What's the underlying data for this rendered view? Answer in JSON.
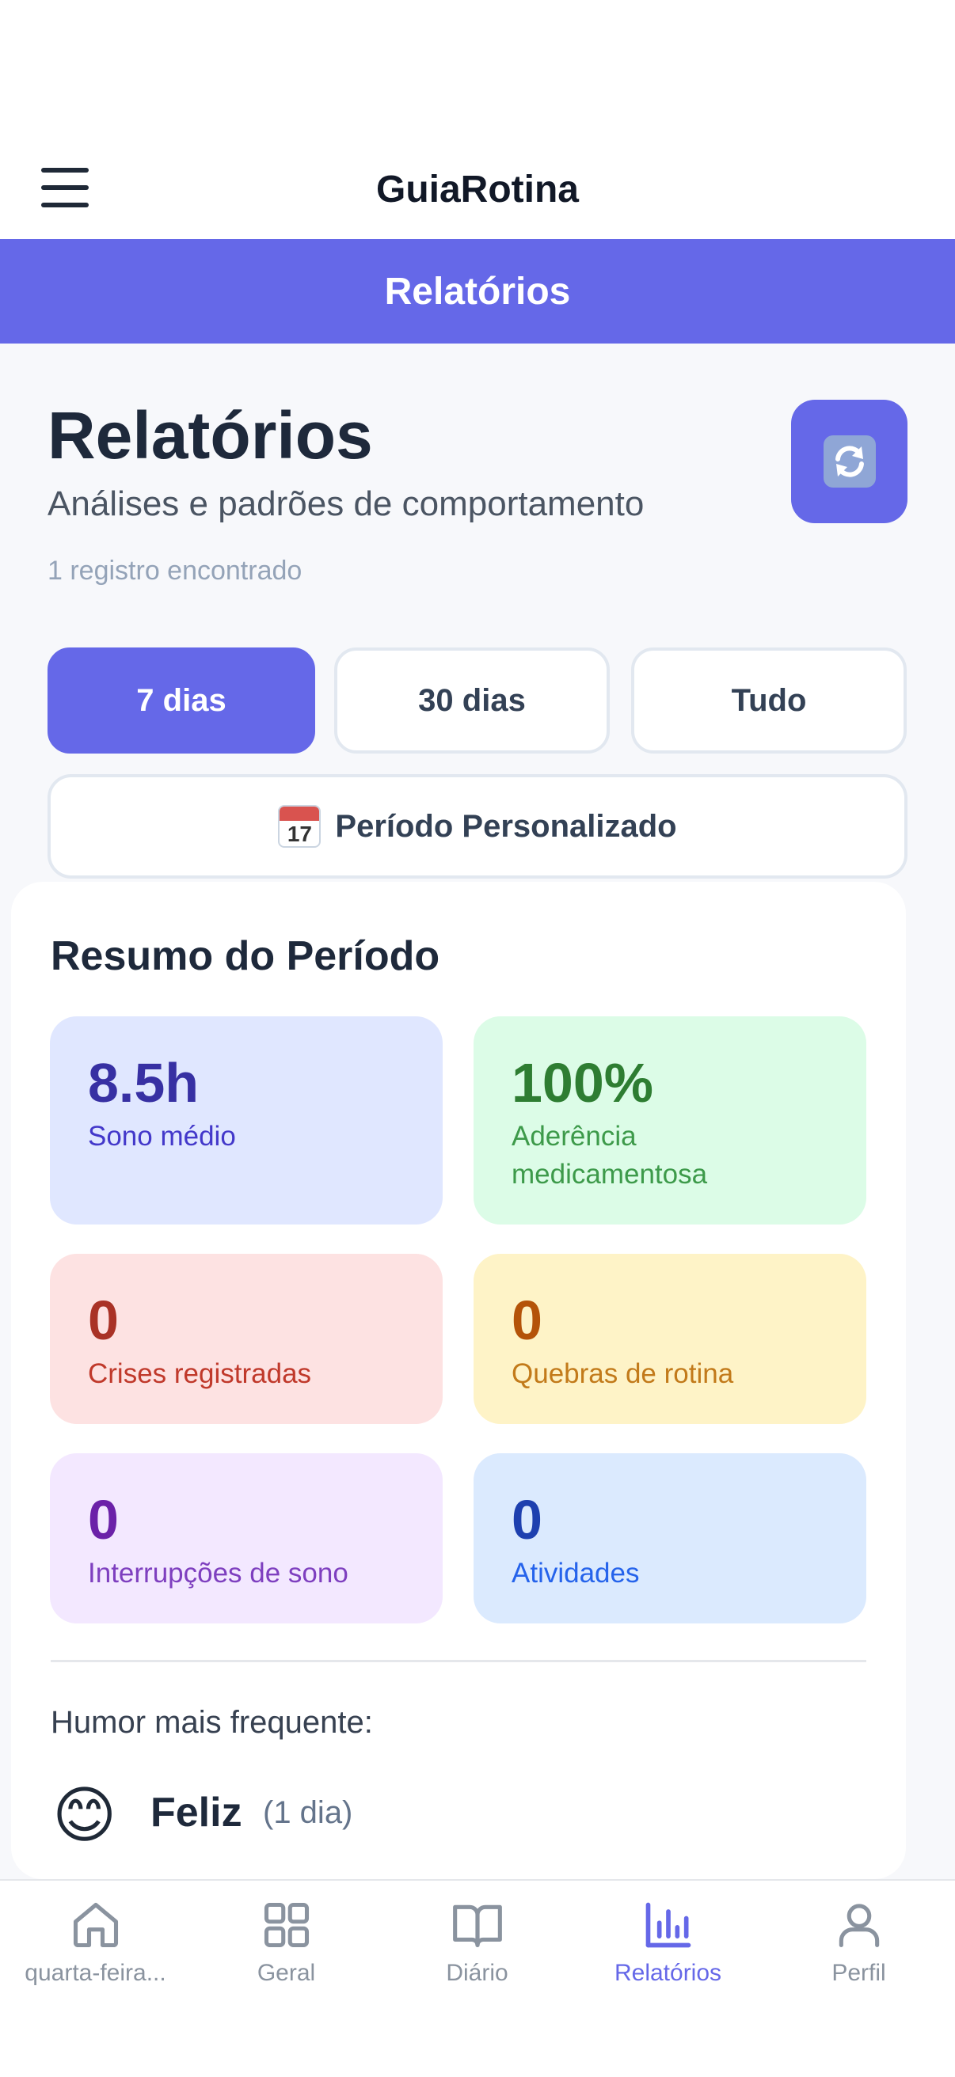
{
  "header": {
    "app_title": "GuiaRotina"
  },
  "section_bar": {
    "title": "Relatórios"
  },
  "page": {
    "title": "Relatórios",
    "subtitle": "Análises e padrões de comportamento",
    "record_count": "1 registro encontrado"
  },
  "periods": [
    {
      "label": "7 dias",
      "active": true
    },
    {
      "label": "30 dias",
      "active": false
    },
    {
      "label": "Tudo",
      "active": false
    }
  ],
  "custom_period": {
    "label": "Período Personalizado",
    "calendar_day": "17"
  },
  "summary": {
    "title": "Resumo do Período",
    "stats": [
      {
        "value": "8.5h",
        "label": "Sono médio",
        "bg": "#e0e7ff",
        "value_color": "#3730a3",
        "label_color": "#4338ca"
      },
      {
        "value": "100%",
        "label": "Aderência medicamentosa",
        "bg": "#dcfce7",
        "value_color": "#2e7d32",
        "label_color": "#3d9a4a"
      },
      {
        "value": "0",
        "label": "Crises registradas",
        "bg": "#fde2e2",
        "value_color": "#a93226",
        "label_color": "#c0392b"
      },
      {
        "value": "0",
        "label": "Quebras de rotina",
        "bg": "#fef3c7",
        "value_color": "#b45309",
        "label_color": "#c27a1a"
      },
      {
        "value": "0",
        "label": "Interrupções de sono",
        "bg": "#f3e8ff",
        "value_color": "#6b21a8",
        "label_color": "#7e3fbf"
      },
      {
        "value": "0",
        "label": "Atividades",
        "bg": "#dbeafe",
        "value_color": "#1e40af",
        "label_color": "#2563eb"
      }
    ],
    "mood": {
      "label": "Humor mais frequente:",
      "emoji": "😊",
      "name": "Feliz",
      "count": "(1 dia)"
    }
  },
  "bottom_nav": [
    {
      "label": "quarta-feira...",
      "icon": "home-icon",
      "active": false
    },
    {
      "label": "Geral",
      "icon": "grid-icon",
      "active": false
    },
    {
      "label": "Diário",
      "icon": "book-icon",
      "active": false
    },
    {
      "label": "Relatórios",
      "icon": "bar-chart-icon",
      "active": true
    },
    {
      "label": "Perfil",
      "icon": "user-icon",
      "active": false
    }
  ],
  "colors": {
    "accent": "#6568e8",
    "inactive_nav": "#8a939f"
  }
}
